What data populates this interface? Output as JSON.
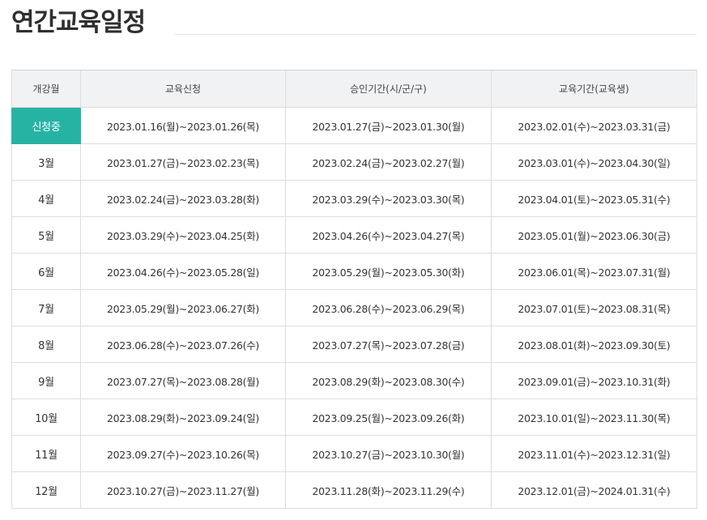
{
  "page": {
    "title": "연간교육일정"
  },
  "table": {
    "headers": [
      "개강월",
      "교육신청",
      "승인기간(시/군/구)",
      "교육기간(교육생)"
    ],
    "rows": [
      {
        "month": "신청중",
        "apply": "2023.01.16(월)~2023.01.26(목)",
        "approve": "2023.01.27(금)~2023.01.30(월)",
        "edu": "2023.02.01(수)~2023.03.31(금)",
        "active": true
      },
      {
        "month": "3월",
        "apply": "2023.01.27(금)~2023.02.23(목)",
        "approve": "2023.02.24(금)~2023.02.27(월)",
        "edu": "2023.03.01(수)~2023.04.30(일)",
        "active": false
      },
      {
        "month": "4월",
        "apply": "2023.02.24(금)~2023.03.28(화)",
        "approve": "2023.03.29(수)~2023.03.30(목)",
        "edu": "2023.04.01(토)~2023.05.31(수)",
        "active": false
      },
      {
        "month": "5월",
        "apply": "2023.03.29(수)~2023.04.25(화)",
        "approve": "2023.04.26(수)~2023.04.27(목)",
        "edu": "2023.05.01(월)~2023.06.30(금)",
        "active": false
      },
      {
        "month": "6월",
        "apply": "2023.04.26(수)~2023.05.28(일)",
        "approve": "2023.05.29(월)~2023.05.30(화)",
        "edu": "2023.06.01(목)~2023.07.31(월)",
        "active": false
      },
      {
        "month": "7월",
        "apply": "2023.05.29(월)~2023.06.27(화)",
        "approve": "2023.06.28(수)~2023.06.29(목)",
        "edu": "2023.07.01(토)~2023.08.31(목)",
        "active": false
      },
      {
        "month": "8월",
        "apply": "2023.06.28(수)~2023.07.26(수)",
        "approve": "2023.07.27(목)~2023.07.28(금)",
        "edu": "2023.08.01(화)~2023.09.30(토)",
        "active": false
      },
      {
        "month": "9월",
        "apply": "2023.07.27(목)~2023.08.28(월)",
        "approve": "2023.08.29(화)~2023.08.30(수)",
        "edu": "2023.09.01(금)~2023.10.31(화)",
        "active": false
      },
      {
        "month": "10월",
        "apply": "2023.08.29(화)~2023.09.24(일)",
        "approve": "2023.09.25(월)~2023.09.26(화)",
        "edu": "2023.10.01(일)~2023.11.30(목)",
        "active": false
      },
      {
        "month": "11월",
        "apply": "2023.09.27(수)~2023.10.26(목)",
        "approve": "2023.10.27(금)~2023.10.30(월)",
        "edu": "2023.11.01(수)~2023.12.31(일)",
        "active": false
      },
      {
        "month": "12월",
        "apply": "2023.10.27(금)~2023.11.27(월)",
        "approve": "2023.11.28(화)~2023.11.29(수)",
        "edu": "2023.12.01(금)~2024.01.31(수)",
        "active": false
      }
    ]
  },
  "colors": {
    "active_month_bg": "#27b3a4",
    "header_bg": "#f0f2f4",
    "border": "#dddddd"
  }
}
